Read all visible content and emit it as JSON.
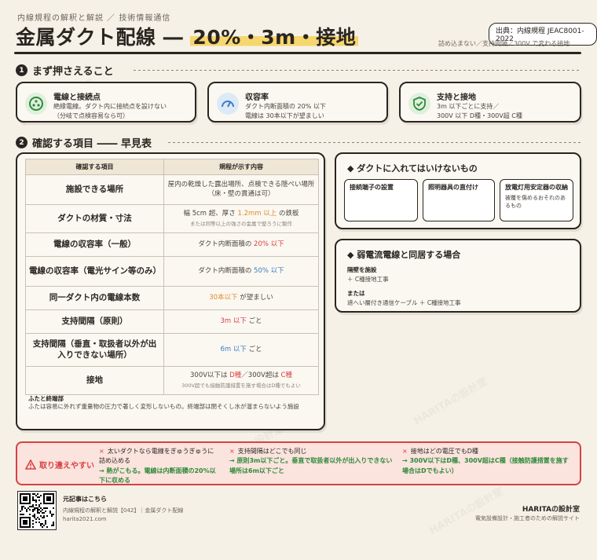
{
  "header": {
    "breadcrumb": "内線規程の解釈と解説 ／ 技術情報通信",
    "title_prefix": "金属ダクト配線 ― ",
    "title_highlight": "20%・3m・接地",
    "source_badge": "出典：内線規程 JEAC8001-2022",
    "subnote": "詰め込まない／支持間隔／300V で変わる接地"
  },
  "section1": {
    "number": "1",
    "title": "まず押さえること",
    "cards": [
      {
        "icon": "connection-point-icon",
        "title": "電線と接続点",
        "lines": [
          "絶縁電線。ダクト内に接続点を設けない",
          "（分岐で点検容易なら可）"
        ],
        "color": "#2f8a3a"
      },
      {
        "icon": "gauge-icon",
        "title": "収容率",
        "lines": [
          "ダクト内断面積の 20% 以下",
          "電線は 30本以下が望ましい"
        ],
        "color": "#3b7ec4"
      },
      {
        "icon": "shield-check-icon",
        "title": "支持と接地",
        "lines": [
          "3m 以下ごとに支持／",
          "300V 以下 D種・300V超 C種"
        ],
        "color": "#2f8a3a"
      }
    ]
  },
  "section2": {
    "number": "2",
    "title": "確認する項目 ―― 早見表"
  },
  "table": {
    "headers": [
      "確認する項目",
      "規程が示す内容"
    ],
    "rows": [
      {
        "item": "施設できる場所",
        "rule_parts": [
          [
            "屋内の乾燥した露出場所、点検できる隠ぺい場所（床・壁の貫通は可）",
            ""
          ]
        ],
        "small": ""
      },
      {
        "item": "ダクトの材質・寸法",
        "rule_parts": [
          [
            "幅 5cm 超、厚さ ",
            ""
          ],
          [
            "1.2mm 以上",
            "or"
          ],
          [
            " の鉄板",
            ""
          ]
        ],
        "small": "または同等以上の強さの金属で堅ろうに製作"
      },
      {
        "item": "電線の収容率（一般）",
        "rule_parts": [
          [
            "ダクト内断面積の ",
            ""
          ],
          [
            "20% 以下",
            "rd"
          ]
        ],
        "small": ""
      },
      {
        "item": "電線の収容率（電光サイン等のみ）",
        "rule_parts": [
          [
            "ダクト内断面積の ",
            ""
          ],
          [
            "50% 以下",
            "bl"
          ]
        ],
        "small": ""
      },
      {
        "item": "同一ダクト内の電線本数",
        "rule_parts": [
          [
            "30本以下",
            "or"
          ],
          [
            " が望ましい",
            ""
          ]
        ],
        "small": ""
      },
      {
        "item": "支持間隔（原則）",
        "rule_parts": [
          [
            "3m 以下",
            "rd"
          ],
          [
            " ごと",
            ""
          ]
        ],
        "small": ""
      },
      {
        "item": "支持間隔（垂直・取扱者以外が出入りできない場所）",
        "rule_parts": [
          [
            "6m 以下",
            "bl"
          ],
          [
            " ごと",
            ""
          ]
        ],
        "small": ""
      },
      {
        "item": "接地",
        "rule_parts": [
          [
            "300V以下は ",
            ""
          ],
          [
            "D種",
            "rd"
          ],
          [
            "／300V超は ",
            ""
          ],
          [
            "C種",
            "rd"
          ]
        ],
        "small": "300V超でも接触防護措置を施す場合はD種でもよい"
      }
    ],
    "footnote_heading": "ふたと終端部",
    "footnote_text": "ふたは容易に外れず重量物の圧力で著しく変形しないもの。終端部は閉そくし水が溜まらないよう施設"
  },
  "panel_forbidden": {
    "title": "◆ ダクトに入れてはいけないもの",
    "items": [
      {
        "title": "接続端子の設置",
        "desc": ""
      },
      {
        "title": "照明器具の直付け",
        "desc": ""
      },
      {
        "title": "放電灯用安定器の収納",
        "desc": "被覆を傷めるおそれのあるもの"
      }
    ]
  },
  "panel_weak": {
    "title": "◆ 弱電流電線と同居する場合",
    "h1": "隔壁を施設",
    "t1": "＋ C種接地工事",
    "h2": "または",
    "t2": "遮へい層付き通信ケーブル ＋ C種接地工事"
  },
  "warning": {
    "label": "取り違えやすい",
    "cols": [
      {
        "wrong": "太いダクトなら電線をぎゅうぎゅうに詰め込める",
        "right": "→ 熱がこもる。電線は内断面積の20%以下に収める"
      },
      {
        "wrong": "支持間隔はどこでも同じ",
        "right": "→ 原則3m以下ごと。垂直で取扱者以外が出入りできない場所は6m以下ごと"
      },
      {
        "wrong": "接地はどの電圧でもD種",
        "right": "→ 300V以下はD種、300V超はC種（接触防護措置を施す場合はDでもよい）"
      }
    ]
  },
  "footer": {
    "link_heading": "元記事はこちら",
    "link_title": "内線規程の解釈と解説【042】｜金属ダクト配線",
    "link_url": "harita2021.com",
    "brand": "HARITAの設計室",
    "brand_sub": "電気設備設計・施工者のための解説サイト",
    "watermark": "HARITAの設計室"
  },
  "colors": {
    "accent": "#f6d66e",
    "green": "#2f8a3a",
    "blue": "#3b7ec4",
    "red": "#d94141",
    "orange": "#e08a2a"
  }
}
